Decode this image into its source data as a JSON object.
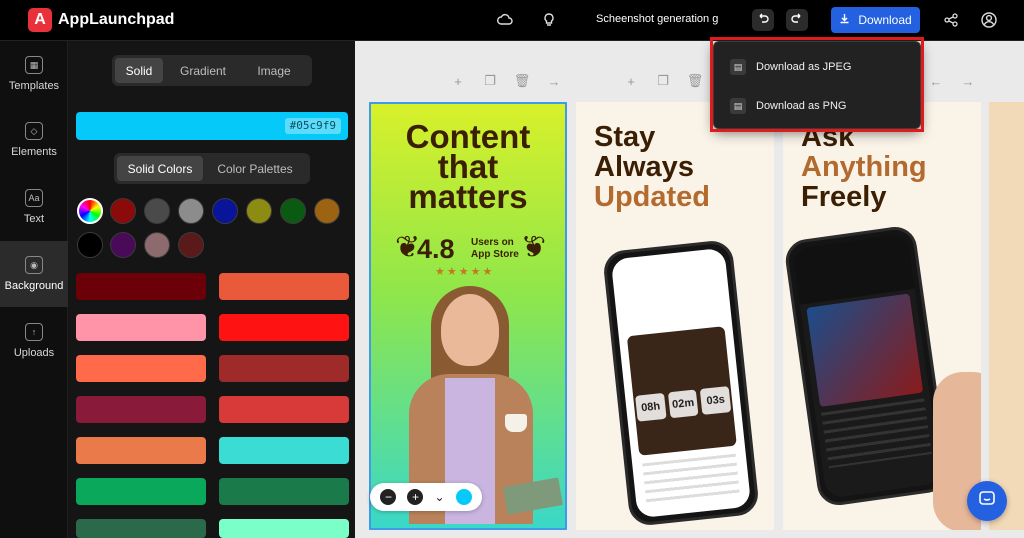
{
  "app": {
    "brand_letter": "A",
    "brand_name": "AppLaunchpad",
    "accent_color": "#2361e0",
    "logo_color": "#e8313a"
  },
  "toolbar": {
    "doc_title": "Scheenshot generation gu",
    "download_label": "Download",
    "icons": [
      "cloud-save-icon",
      "lightbulb-icon",
      "undo-icon",
      "redo-icon",
      "download-icon",
      "share-icon",
      "account-icon"
    ]
  },
  "download_menu": {
    "items": [
      {
        "label": "Download as JPEG",
        "icon": "image-file-icon"
      },
      {
        "label": "Download as PNG",
        "icon": "image-file-icon"
      }
    ]
  },
  "nav": {
    "items": [
      {
        "label": "Templates",
        "icon": "grid-icon"
      },
      {
        "label": "Elements",
        "icon": "shapes-icon"
      },
      {
        "label": "Text",
        "icon": "text-icon",
        "glyph": "Aa"
      },
      {
        "label": "Background",
        "icon": "palette-icon",
        "active": true
      },
      {
        "label": "Uploads",
        "icon": "upload-icon"
      }
    ]
  },
  "panel": {
    "fill_tabs": [
      "Solid",
      "Gradient",
      "Image"
    ],
    "fill_active": "Solid",
    "current_hex": "#05c9f9",
    "color_tabs": [
      "Solid Colors",
      "Color Palettes"
    ],
    "color_active": "Solid Colors",
    "swatches": [
      "rainbow",
      "#8b0a0a",
      "#4a4a4a",
      "#8c8c8c",
      "#0a1499",
      "#8c8c12",
      "#0a5a12",
      "#9c6412",
      "#000000",
      "#4a0a5a",
      "#8c6a6e",
      "#5a1a1a"
    ],
    "bars": [
      "#6b0008",
      "#ea5a3a",
      "#ff94a8",
      "#ff1212",
      "#ff6a4a",
      "#9e2a2a",
      "#8a1a3a",
      "#d83a3a",
      "#ea7a4a",
      "#3adcd4",
      "#0aa85a",
      "#1a7a4a",
      "#2a6a4a",
      "#7affc8"
    ]
  },
  "canvas": {
    "slide_controls": [
      "plus-icon",
      "duplicate-icon",
      "trash-icon",
      "arrow-right-icon"
    ],
    "slide1": {
      "headline": [
        "Content",
        "that",
        "matters"
      ],
      "rating": "4.8",
      "rating_text_1": "Users on",
      "rating_text_2": "App Store",
      "stars": "★★★★★"
    },
    "slide2": {
      "headline_1": "Stay",
      "headline_2": "Always",
      "headline_3": "Updated",
      "timer": [
        "08h",
        "02m",
        "03s"
      ]
    },
    "slide3": {
      "headline_1": "Ask",
      "headline_2": "Anything",
      "headline_3": "Freely"
    },
    "zoom_controls": [
      "zoom-out-icon",
      "zoom-in-icon",
      "collapse-icon",
      "color-dot-icon"
    ]
  }
}
